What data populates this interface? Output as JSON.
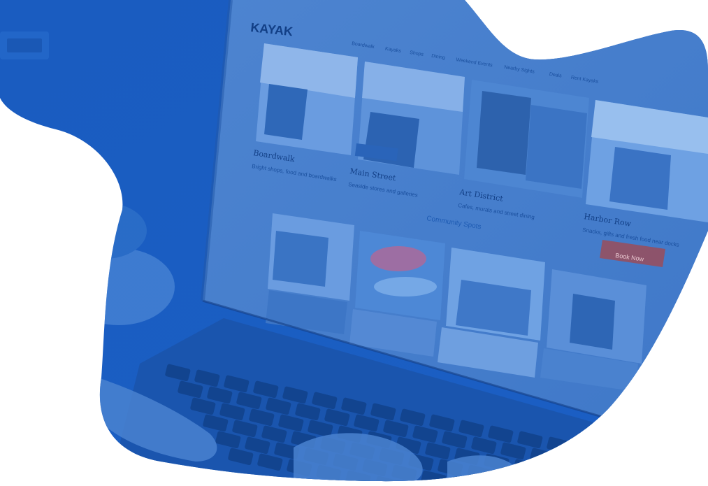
{
  "colors": {
    "background": "#ffffff",
    "overlay_blue": "#1e64c8",
    "overlay_deep": "#1651a8",
    "screen_light": "#4f86d2",
    "accent_button": "#a04a52"
  },
  "site": {
    "logo": "KAYAK",
    "nav": [
      "Boardwalk",
      "Kayaks",
      "Shops",
      "Dining",
      "Weekend Events",
      "Nearby Sights",
      "Deals",
      "Rent Kayaks"
    ],
    "cards": [
      {
        "title": "Boardwalk",
        "subtitle": "Bright shops, food and boardwalks"
      },
      {
        "title": "Main Street",
        "subtitle": "Seaside stores and galleries"
      },
      {
        "title": "Art District",
        "subtitle": "Cafes, murals and street dining"
      },
      {
        "title": "Harbor Row",
        "subtitle": "Snacks, gifts and fresh food near docks"
      }
    ],
    "button_label": "Book Now",
    "section_heading": "Community Spots"
  }
}
